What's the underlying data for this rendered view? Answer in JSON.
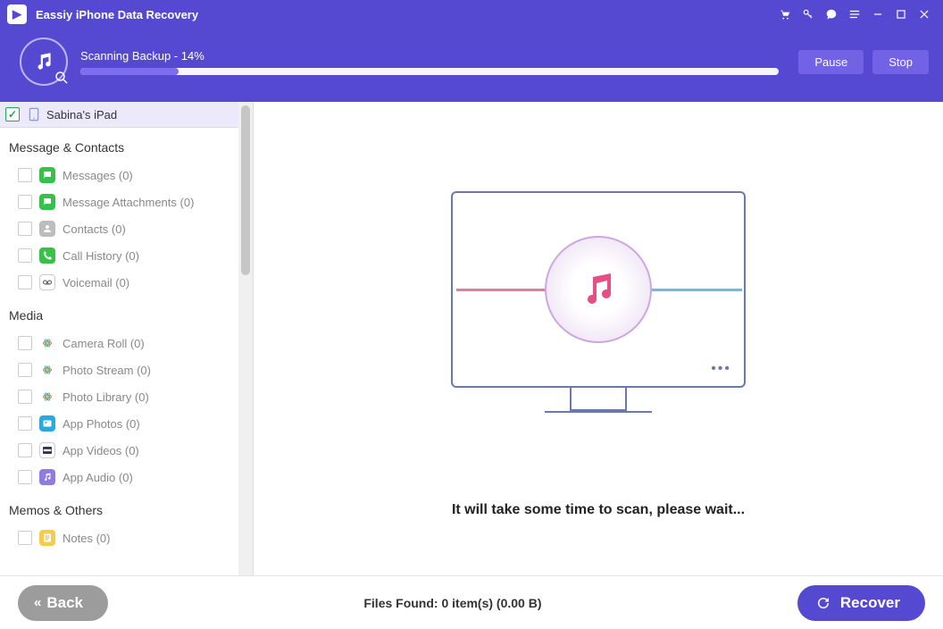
{
  "app": {
    "title": "Eassiy iPhone Data Recovery"
  },
  "header": {
    "progress_label": "Scanning Backup - 14%",
    "progress_pct": 14,
    "pause": "Pause",
    "stop": "Stop"
  },
  "device": {
    "name": "Sabina's iPad"
  },
  "groups": [
    {
      "title": "Message & Contacts",
      "items": [
        {
          "label": "Messages (0)",
          "icon": "chat",
          "bg": "#35c14a"
        },
        {
          "label": "Message Attachments (0)",
          "icon": "chat",
          "bg": "#35c14a"
        },
        {
          "label": "Contacts (0)",
          "icon": "contact",
          "bg": "#bdbdbd"
        },
        {
          "label": "Call History (0)",
          "icon": "phone",
          "bg": "#35c14a"
        },
        {
          "label": "Voicemail (0)",
          "icon": "voicemail",
          "bg": "#ffffff",
          "border": true
        }
      ]
    },
    {
      "title": "Media",
      "items": [
        {
          "label": "Camera Roll (0)",
          "icon": "flower",
          "bg": "#ffffff",
          "rainbow": true
        },
        {
          "label": "Photo Stream (0)",
          "icon": "flower",
          "bg": "#ffffff",
          "rainbow": true
        },
        {
          "label": "Photo Library (0)",
          "icon": "flower",
          "bg": "#ffffff",
          "rainbow": true
        },
        {
          "label": "App Photos (0)",
          "icon": "photo",
          "bg": "#2aa9e0"
        },
        {
          "label": "App Videos (0)",
          "icon": "video",
          "bg": "#ffffff",
          "border": true
        },
        {
          "label": "App Audio (0)",
          "icon": "audio",
          "bg": "#8e7ce0"
        }
      ]
    },
    {
      "title": "Memos & Others",
      "items": [
        {
          "label": "Notes (0)",
          "icon": "notes",
          "bg": "#f7cc4a"
        }
      ]
    }
  ],
  "main": {
    "wait_text": "It will take some time to scan, please wait..."
  },
  "footer": {
    "back": "Back",
    "status": "Files Found: 0 item(s) (0.00 B)",
    "recover": "Recover"
  }
}
